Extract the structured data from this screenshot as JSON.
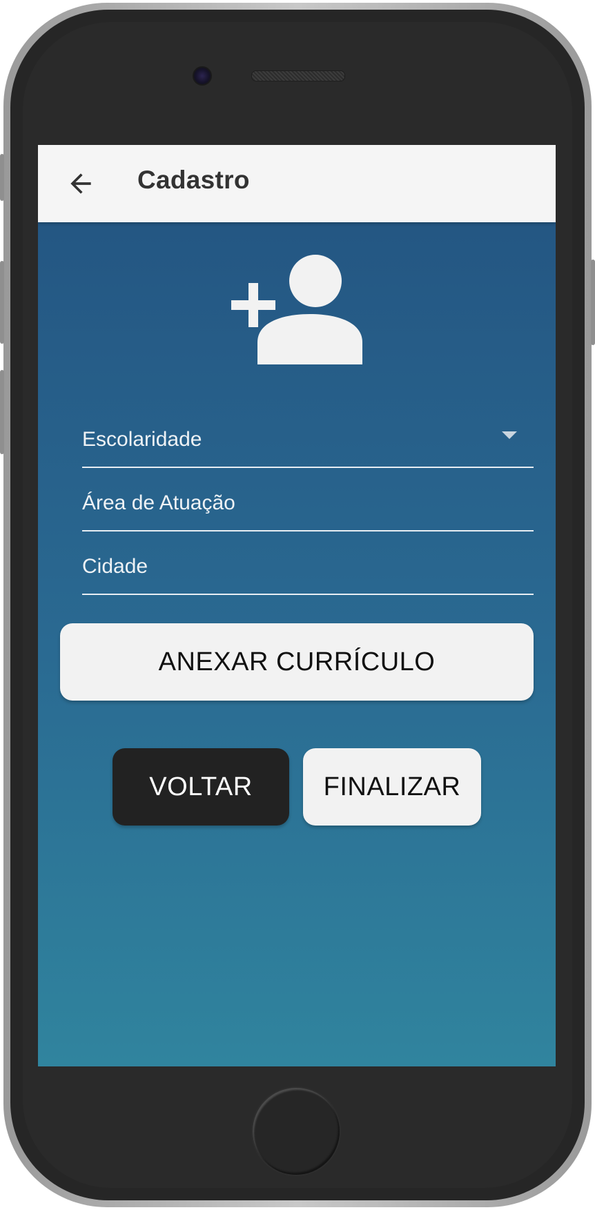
{
  "app_bar": {
    "title": "Cadastro",
    "back_icon": "arrow-back-icon"
  },
  "header_icon": "person-add-icon",
  "form": {
    "fields": [
      {
        "label": "Escolaridade",
        "type": "dropdown"
      },
      {
        "label": "Área de Atuação",
        "type": "text"
      },
      {
        "label": "Cidade",
        "type": "text"
      }
    ]
  },
  "buttons": {
    "attach_resume": "ANEXAR CURRÍCULO",
    "back": "VOLTAR",
    "finish": "FINALIZAR"
  },
  "colors": {
    "screen_gradient_top": "#235380",
    "screen_gradient_bottom": "#30849e",
    "app_bar": "#f5f5f5",
    "button_light": "#f2f2f2",
    "button_dark": "#222222"
  }
}
